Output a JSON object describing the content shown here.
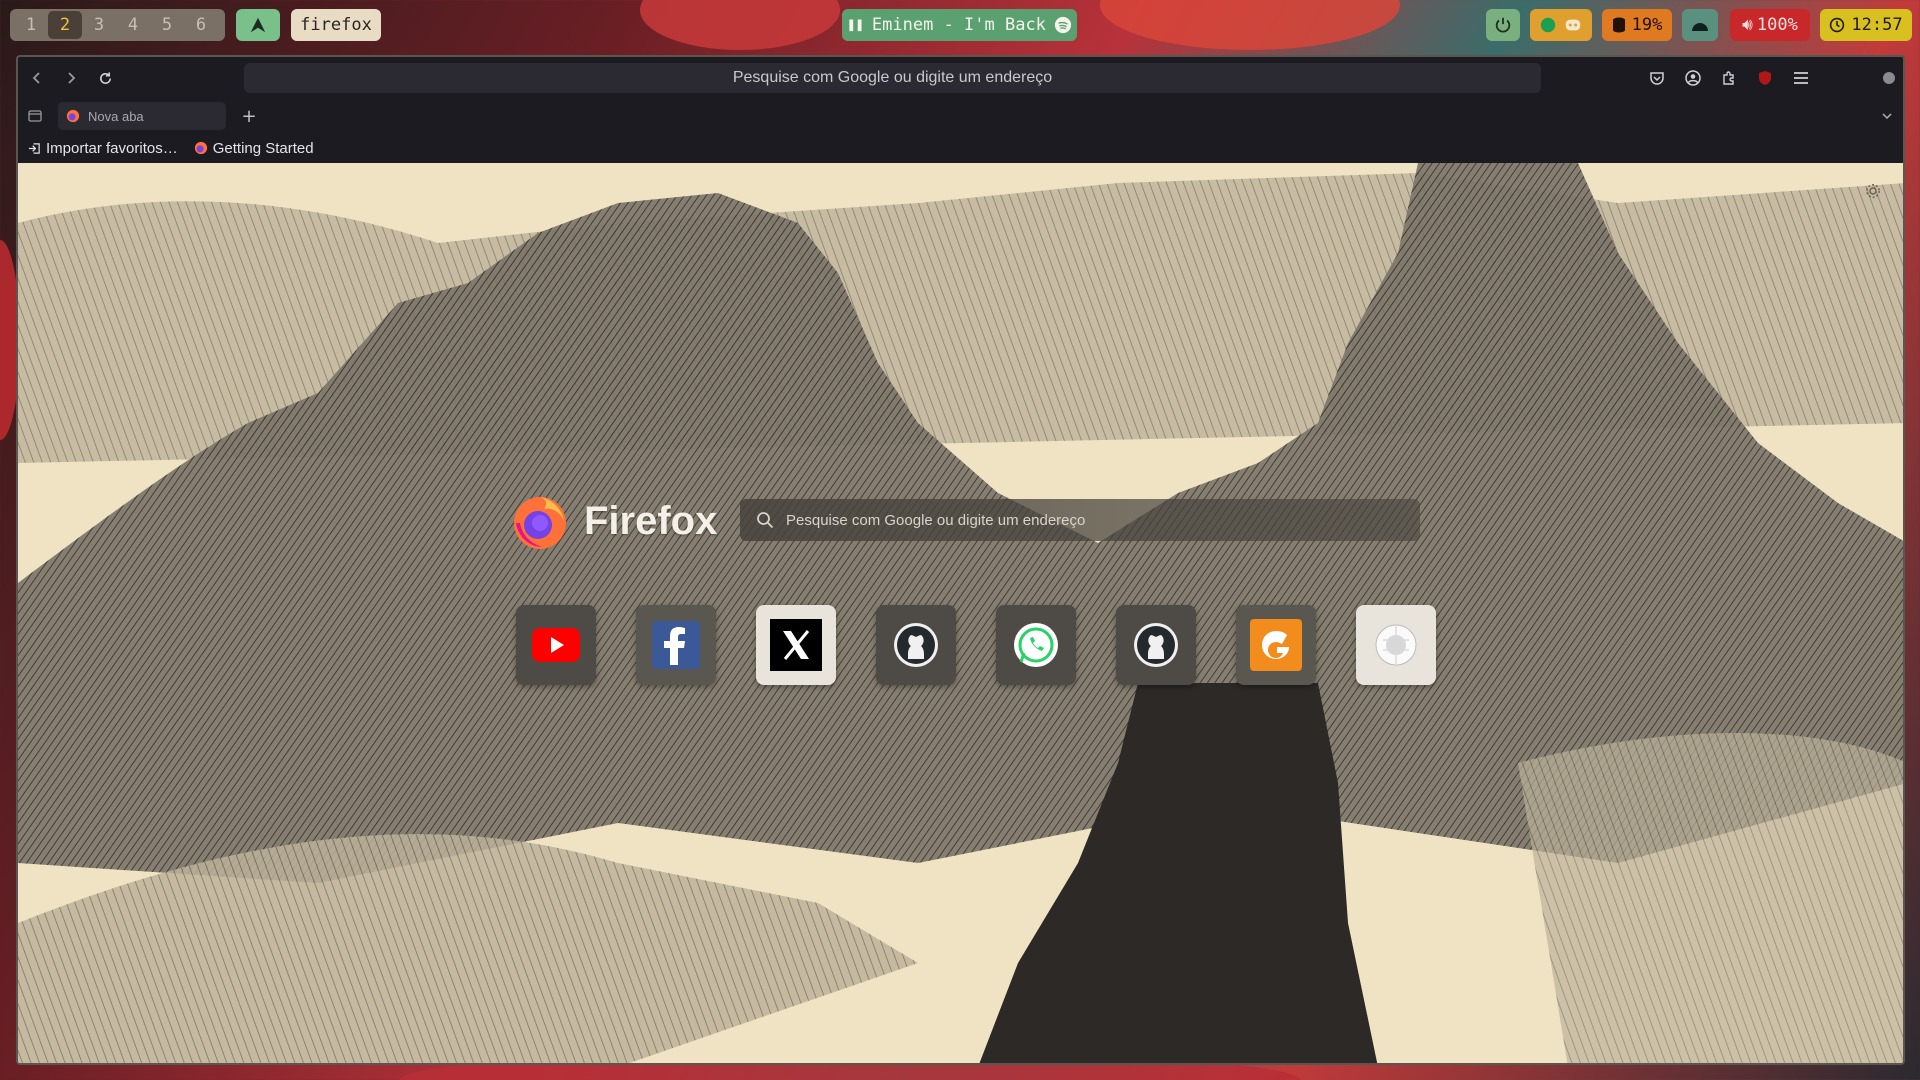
{
  "topbar": {
    "workspaces": [
      "1",
      "2",
      "3",
      "4",
      "5",
      "6"
    ],
    "active_workspace": "2",
    "app_name": "firefox",
    "media": "Eminem - I'm Back",
    "disk": "19%",
    "volume": "100%",
    "clock": "12:57"
  },
  "browser": {
    "urlbar_placeholder": "Pesquise com Google ou digite um endereço",
    "tab_title": "Nova aba",
    "new_tab_symbol": "+",
    "bookmarks": [
      "Importar favoritos…",
      "Getting Started"
    ]
  },
  "newtab": {
    "brand": "Firefox",
    "search_placeholder": "Pesquise com Google ou digite um endereço",
    "shortcuts": [
      "youtube",
      "facebook",
      "x",
      "github",
      "whatsapp",
      "github",
      "g",
      "wikipedia"
    ]
  },
  "colors": {
    "accent_workspace": "#f0c040",
    "content_bg": "#efe3c4",
    "chrome_bg": "#1c1b22"
  }
}
